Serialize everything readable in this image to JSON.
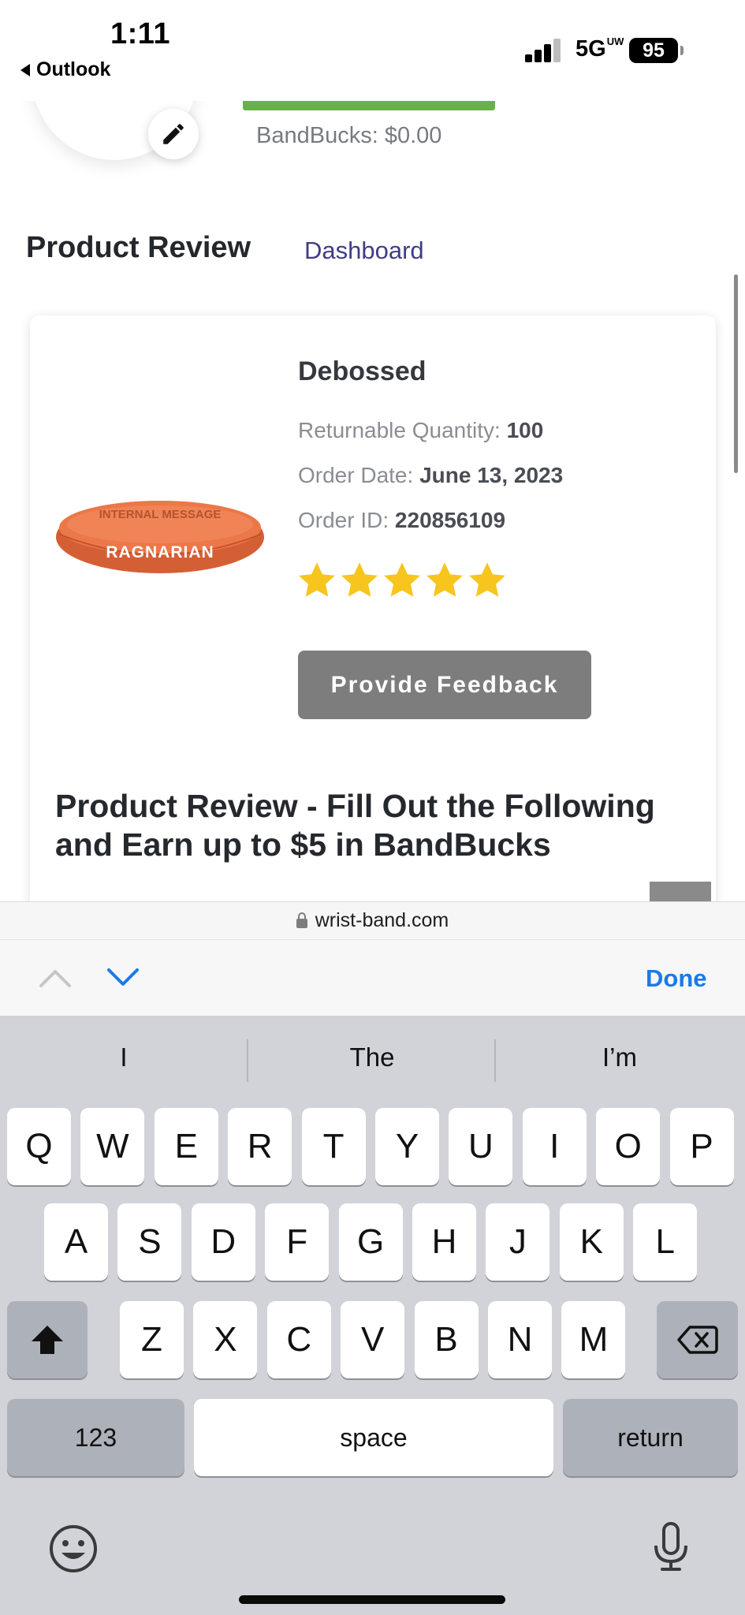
{
  "status_bar": {
    "time": "1:11",
    "back_app": "Outlook",
    "network": "5G",
    "network_suffix": "UW",
    "battery": "95"
  },
  "profile": {
    "bandbucks_label": "BandBucks: $0.00"
  },
  "header": {
    "title": "Product Review",
    "dashboard_link": "Dashboard"
  },
  "product": {
    "name": "Debossed",
    "image_text_top": "INTERNAL MESSAGE",
    "image_text_main": "RAGNARIAN",
    "quantity_label": "Returnable Quantity:",
    "quantity_value": "100",
    "date_label": "Order Date:",
    "date_value": "June 13, 2023",
    "order_id_label": "Order ID:",
    "order_id_value": "220856109",
    "rating": 5,
    "rating_max": 5,
    "feedback_button": "Provide Feedback"
  },
  "review_heading": "Product Review - Fill Out the Following and Earn up to $5 in BandBucks",
  "browser": {
    "url": "wrist-band.com",
    "done_label": "Done"
  },
  "keyboard": {
    "suggestions": [
      "I",
      "The",
      "I’m"
    ],
    "row1": [
      "Q",
      "W",
      "E",
      "R",
      "T",
      "Y",
      "U",
      "I",
      "O",
      "P"
    ],
    "row2": [
      "A",
      "S",
      "D",
      "F",
      "G",
      "H",
      "J",
      "K",
      "L"
    ],
    "row3": [
      "Z",
      "X",
      "C",
      "V",
      "B",
      "N",
      "M"
    ],
    "numbers_label": "123",
    "space_label": "space",
    "return_label": "return"
  },
  "colors": {
    "accent_link": "#3f3d86",
    "progress_green": "#6ab04c",
    "star_yellow": "#f7c51d",
    "done_blue": "#1a7ae8",
    "product_orange": "#e0683f"
  }
}
